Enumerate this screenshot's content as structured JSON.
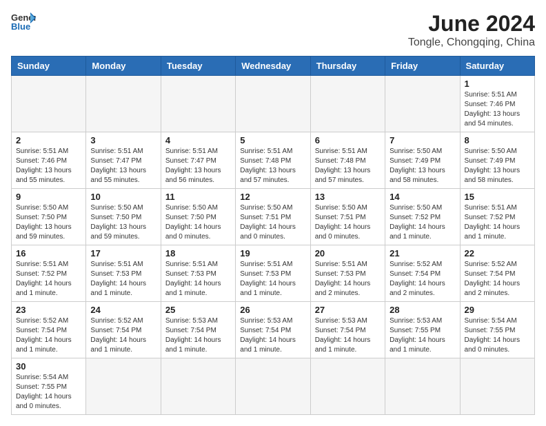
{
  "header": {
    "logo_general": "General",
    "logo_blue": "Blue",
    "month_year": "June 2024",
    "location": "Tongle, Chongqing, China"
  },
  "days_of_week": [
    "Sunday",
    "Monday",
    "Tuesday",
    "Wednesday",
    "Thursday",
    "Friday",
    "Saturday"
  ],
  "weeks": [
    [
      {
        "day": "",
        "info": ""
      },
      {
        "day": "",
        "info": ""
      },
      {
        "day": "",
        "info": ""
      },
      {
        "day": "",
        "info": ""
      },
      {
        "day": "",
        "info": ""
      },
      {
        "day": "",
        "info": ""
      },
      {
        "day": "1",
        "info": "Sunrise: 5:51 AM\nSunset: 7:46 PM\nDaylight: 13 hours\nand 54 minutes."
      }
    ],
    [
      {
        "day": "2",
        "info": "Sunrise: 5:51 AM\nSunset: 7:46 PM\nDaylight: 13 hours\nand 55 minutes."
      },
      {
        "day": "3",
        "info": "Sunrise: 5:51 AM\nSunset: 7:47 PM\nDaylight: 13 hours\nand 55 minutes."
      },
      {
        "day": "4",
        "info": "Sunrise: 5:51 AM\nSunset: 7:47 PM\nDaylight: 13 hours\nand 56 minutes."
      },
      {
        "day": "5",
        "info": "Sunrise: 5:51 AM\nSunset: 7:48 PM\nDaylight: 13 hours\nand 57 minutes."
      },
      {
        "day": "6",
        "info": "Sunrise: 5:51 AM\nSunset: 7:48 PM\nDaylight: 13 hours\nand 57 minutes."
      },
      {
        "day": "7",
        "info": "Sunrise: 5:50 AM\nSunset: 7:49 PM\nDaylight: 13 hours\nand 58 minutes."
      },
      {
        "day": "8",
        "info": "Sunrise: 5:50 AM\nSunset: 7:49 PM\nDaylight: 13 hours\nand 58 minutes."
      }
    ],
    [
      {
        "day": "9",
        "info": "Sunrise: 5:50 AM\nSunset: 7:50 PM\nDaylight: 13 hours\nand 59 minutes."
      },
      {
        "day": "10",
        "info": "Sunrise: 5:50 AM\nSunset: 7:50 PM\nDaylight: 13 hours\nand 59 minutes."
      },
      {
        "day": "11",
        "info": "Sunrise: 5:50 AM\nSunset: 7:50 PM\nDaylight: 14 hours\nand 0 minutes."
      },
      {
        "day": "12",
        "info": "Sunrise: 5:50 AM\nSunset: 7:51 PM\nDaylight: 14 hours\nand 0 minutes."
      },
      {
        "day": "13",
        "info": "Sunrise: 5:50 AM\nSunset: 7:51 PM\nDaylight: 14 hours\nand 0 minutes."
      },
      {
        "day": "14",
        "info": "Sunrise: 5:50 AM\nSunset: 7:52 PM\nDaylight: 14 hours\nand 1 minute."
      },
      {
        "day": "15",
        "info": "Sunrise: 5:51 AM\nSunset: 7:52 PM\nDaylight: 14 hours\nand 1 minute."
      }
    ],
    [
      {
        "day": "16",
        "info": "Sunrise: 5:51 AM\nSunset: 7:52 PM\nDaylight: 14 hours\nand 1 minute."
      },
      {
        "day": "17",
        "info": "Sunrise: 5:51 AM\nSunset: 7:53 PM\nDaylight: 14 hours\nand 1 minute."
      },
      {
        "day": "18",
        "info": "Sunrise: 5:51 AM\nSunset: 7:53 PM\nDaylight: 14 hours\nand 1 minute."
      },
      {
        "day": "19",
        "info": "Sunrise: 5:51 AM\nSunset: 7:53 PM\nDaylight: 14 hours\nand 1 minute."
      },
      {
        "day": "20",
        "info": "Sunrise: 5:51 AM\nSunset: 7:53 PM\nDaylight: 14 hours\nand 2 minutes."
      },
      {
        "day": "21",
        "info": "Sunrise: 5:52 AM\nSunset: 7:54 PM\nDaylight: 14 hours\nand 2 minutes."
      },
      {
        "day": "22",
        "info": "Sunrise: 5:52 AM\nSunset: 7:54 PM\nDaylight: 14 hours\nand 2 minutes."
      }
    ],
    [
      {
        "day": "23",
        "info": "Sunrise: 5:52 AM\nSunset: 7:54 PM\nDaylight: 14 hours\nand 1 minute."
      },
      {
        "day": "24",
        "info": "Sunrise: 5:52 AM\nSunset: 7:54 PM\nDaylight: 14 hours\nand 1 minute."
      },
      {
        "day": "25",
        "info": "Sunrise: 5:53 AM\nSunset: 7:54 PM\nDaylight: 14 hours\nand 1 minute."
      },
      {
        "day": "26",
        "info": "Sunrise: 5:53 AM\nSunset: 7:54 PM\nDaylight: 14 hours\nand 1 minute."
      },
      {
        "day": "27",
        "info": "Sunrise: 5:53 AM\nSunset: 7:54 PM\nDaylight: 14 hours\nand 1 minute."
      },
      {
        "day": "28",
        "info": "Sunrise: 5:53 AM\nSunset: 7:55 PM\nDaylight: 14 hours\nand 1 minute."
      },
      {
        "day": "29",
        "info": "Sunrise: 5:54 AM\nSunset: 7:55 PM\nDaylight: 14 hours\nand 0 minutes."
      }
    ],
    [
      {
        "day": "30",
        "info": "Sunrise: 5:54 AM\nSunset: 7:55 PM\nDaylight: 14 hours\nand 0 minutes."
      },
      {
        "day": "",
        "info": ""
      },
      {
        "day": "",
        "info": ""
      },
      {
        "day": "",
        "info": ""
      },
      {
        "day": "",
        "info": ""
      },
      {
        "day": "",
        "info": ""
      },
      {
        "day": "",
        "info": ""
      }
    ]
  ]
}
